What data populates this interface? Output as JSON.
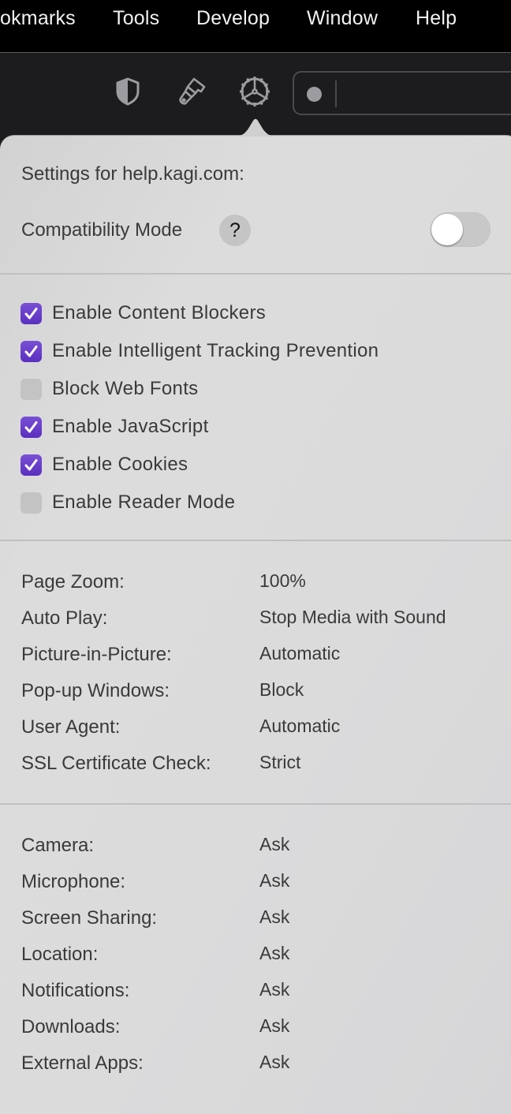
{
  "menubar": {
    "items": [
      {
        "label": "okmarks"
      },
      {
        "label": "Tools"
      },
      {
        "label": "Develop"
      },
      {
        "label": "Window"
      },
      {
        "label": "Help"
      }
    ]
  },
  "toolbar": {
    "icons": [
      "shield-icon",
      "paintbrush-icon",
      "gear-icon"
    ],
    "address_bar": {
      "value": "",
      "status_indicator": "gray-dot"
    }
  },
  "popover": {
    "heading": "Settings for help.kagi.com:",
    "compatibility_mode": {
      "label": "Compatibility Mode",
      "help_label": "?",
      "enabled": false
    },
    "checkboxes": [
      {
        "label": "Enable Content Blockers",
        "checked": true
      },
      {
        "label": "Enable Intelligent Tracking Prevention",
        "checked": true
      },
      {
        "label": "Block Web Fonts",
        "checked": false
      },
      {
        "label": "Enable JavaScript",
        "checked": true
      },
      {
        "label": "Enable Cookies",
        "checked": true
      },
      {
        "label": "Enable Reader Mode",
        "checked": false
      }
    ],
    "page_settings": [
      {
        "label": "Page Zoom:",
        "value": "100%"
      },
      {
        "label": "Auto Play:",
        "value": "Stop Media with Sound"
      },
      {
        "label": "Picture-in-Picture:",
        "value": "Automatic"
      },
      {
        "label": "Pop-up Windows:",
        "value": "Block"
      },
      {
        "label": "User Agent:",
        "value": "Automatic"
      },
      {
        "label": "SSL Certificate Check:",
        "value": "Strict"
      }
    ],
    "permissions": [
      {
        "label": "Camera:",
        "value": "Ask"
      },
      {
        "label": "Microphone:",
        "value": "Ask"
      },
      {
        "label": "Screen Sharing:",
        "value": "Ask"
      },
      {
        "label": "Location:",
        "value": "Ask"
      },
      {
        "label": "Notifications:",
        "value": "Ask"
      },
      {
        "label": "Downloads:",
        "value": "Ask"
      },
      {
        "label": "External Apps:",
        "value": "Ask"
      }
    ]
  },
  "colors": {
    "accent_checkbox": "#6a3fcf",
    "popover_bg": "#dadadb",
    "toolbar_bg": "#1c1c1e",
    "menubar_bg": "#000000"
  }
}
